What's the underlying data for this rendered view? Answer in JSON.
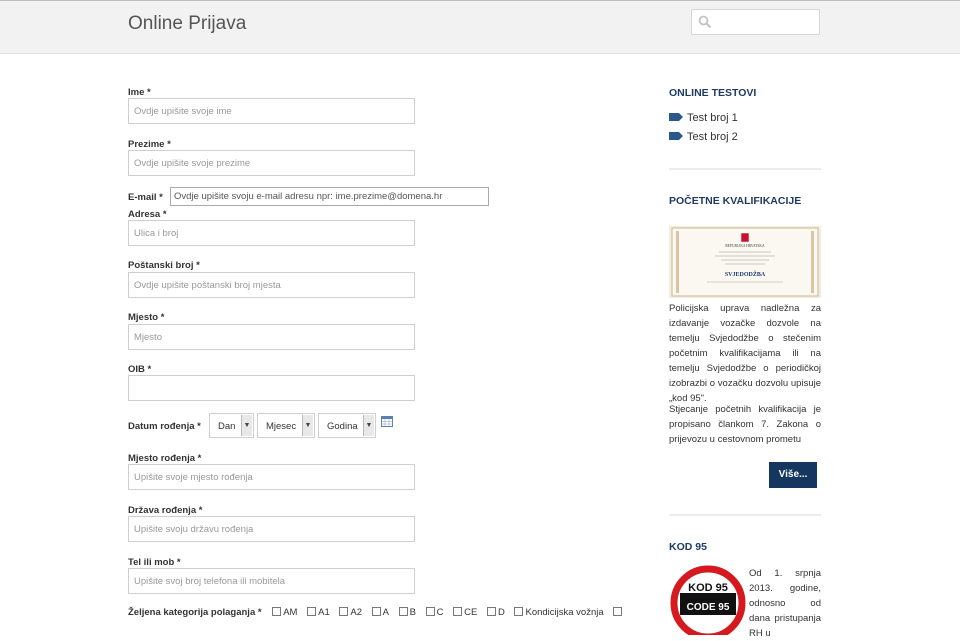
{
  "header": {
    "title": "Online Prijava",
    "search_placeholder": ""
  },
  "form": {
    "ime": {
      "label": "Ime *",
      "placeholder": "Ovdje upišite svoje ime"
    },
    "prezime": {
      "label": "Prezime *",
      "placeholder": "Ovdje upišite svoje prezime"
    },
    "email": {
      "label": "E-mail *",
      "placeholder": "Ovdje upišite svoju e-mail adresu npr: ime.prezime@domena.hr"
    },
    "adresa": {
      "label": "Adresa *",
      "placeholder": "Ulica i broj"
    },
    "postanski": {
      "label": "Poštanski broj *",
      "placeholder": "Ovdje upišite poštanski broj mjesta"
    },
    "mjesto": {
      "label": "Mjesto *",
      "placeholder": "Mjesto"
    },
    "oib": {
      "label": "OIB *",
      "placeholder": ""
    },
    "datum": {
      "label": "Datum rođenja *",
      "dan": "Dan",
      "mjesec": "Mjesec",
      "godina": "Godina"
    },
    "mjesto_rodenja": {
      "label": "Mjesto rođenja *",
      "placeholder": "Upišite svoje mjesto rođenja"
    },
    "drzava_rodenja": {
      "label": "Država rođenja *",
      "placeholder": "Upišite svoju državu rođenja"
    },
    "tel": {
      "label": "Tel ili mob *",
      "placeholder": "Upišite svoj broj telefona ili mobitela"
    },
    "kategorija": {
      "label": "Željena kategorija polaganja *",
      "options": [
        "AM",
        "A1",
        "A2",
        "A",
        "B",
        "C",
        "CE",
        "D",
        "Kondicijska vožnja"
      ]
    }
  },
  "sidebar": {
    "online_testovi": {
      "heading": "ONLINE TESTOVI",
      "links": [
        "Test broj 1",
        "Test broj 2"
      ]
    },
    "pocetne": {
      "heading": "POČETNE KVALIFIKACIJE",
      "cert_republic": "REPUBLIKA HRVATSKA",
      "cert_title": "SVJEDODŽBA",
      "para1": "Policijska uprava nadležna za izdavanje vozačke dozvole na temelju Svjedodžbe o stečenim početnim kvalifikacijama ili na temelju Svjedodžbe o periodičkoj izobrazbi o vozačku dozvolu upisuje „kod 95\".",
      "para2": "Stjecanje početnih kvalifikacija je propisano člankom 7. Zakona o prijevozu u cestovnom prometu",
      "button": "Više..."
    },
    "kod95": {
      "heading": "KOD 95",
      "sign_top": "KOD 95",
      "sign_bottom": "CODE 95",
      "text": "Od 1. srpnja 2013. godine, odnosno od dana pristupanja RH u"
    }
  },
  "colors": {
    "accent": "#14365f",
    "heading": "#1f3a63"
  }
}
